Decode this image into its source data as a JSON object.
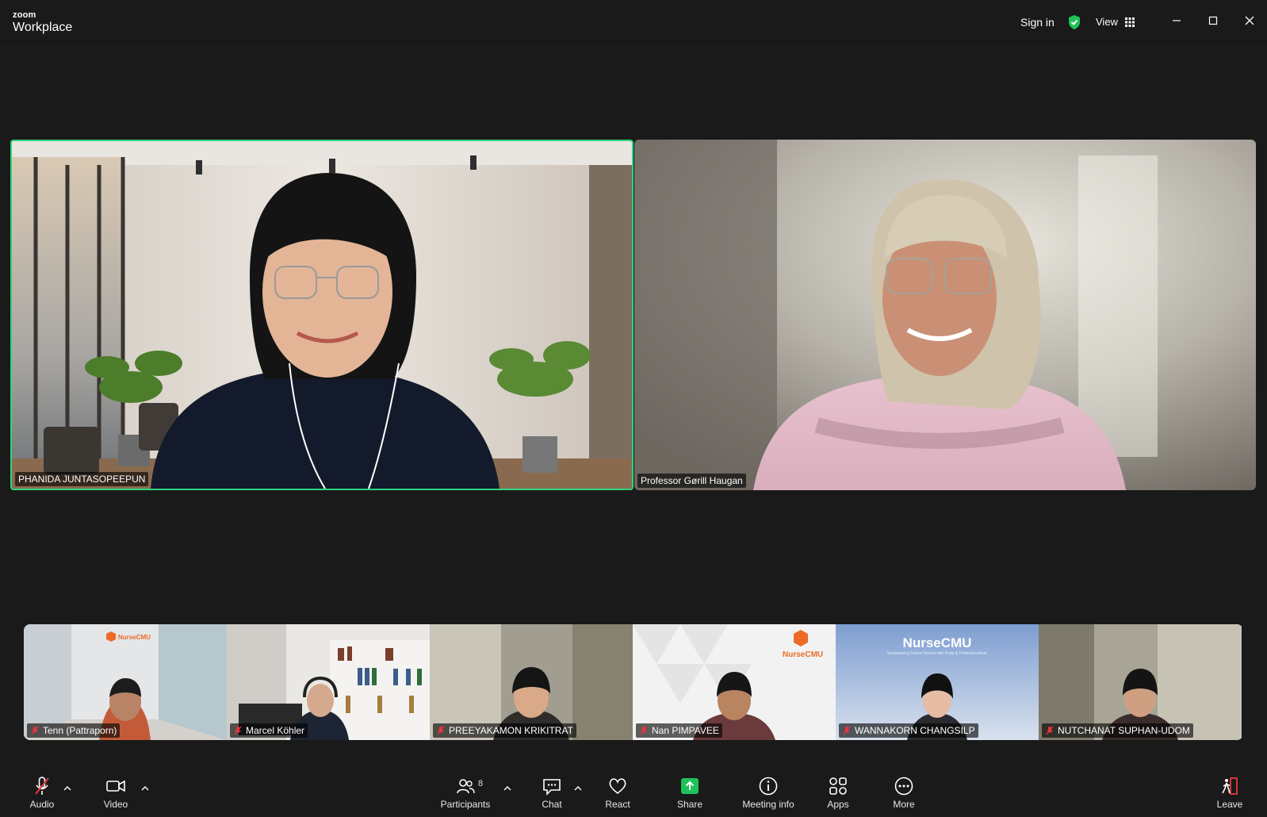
{
  "app": {
    "brand_small": "zoom",
    "brand_name": "Workplace",
    "sign_in": "Sign in",
    "view_label": "View"
  },
  "participants": {
    "spotlight_left": {
      "name": "PHANIDA JUNTASOPEEPUN",
      "speaking": true
    },
    "spotlight_right": {
      "name": "Professor Gørill Haugan"
    },
    "gallery": [
      {
        "name": "Tenn (Pattraporn)",
        "muted": true,
        "logo_text": "NurseCMU"
      },
      {
        "name": "Marcel Köhler",
        "muted": true
      },
      {
        "name": "PREEYAKAMON KRIKITRAT",
        "muted": true
      },
      {
        "name": "Nan PIMPAVEE",
        "muted": true,
        "logo_text": "NurseCMU"
      },
      {
        "name": "WANNAKORN CHANGSILP",
        "muted": true,
        "banner_title": "NurseCMU",
        "banner_sub": "Empowering Future Nurses with Pride & Professionalism"
      },
      {
        "name": "NUTCHANAT SUPHAN-UDOM",
        "muted": true
      }
    ]
  },
  "toolbar": {
    "audio": "Audio",
    "video": "Video",
    "participants": "Participants",
    "participant_count": "8",
    "chat": "Chat",
    "react": "React",
    "share": "Share",
    "meeting_info": "Meeting info",
    "apps": "Apps",
    "more": "More",
    "leave": "Leave"
  },
  "colors": {
    "active_speaker_border": "#2ed47a",
    "share_green": "#20c15a",
    "mute_red": "#e8363b",
    "leave_red": "#e8363b",
    "background": "#1a1a1a"
  }
}
